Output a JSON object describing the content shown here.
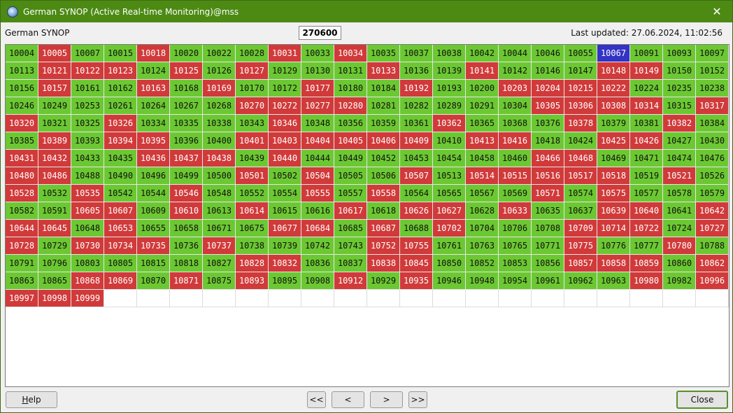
{
  "window": {
    "title": "German SYNOP (Active Real-time Monitoring)@mss"
  },
  "info": {
    "name": "German SYNOP",
    "center_value": "270600",
    "last_updated": "Last updated: 27.06.2024, 11:02:56"
  },
  "colors": {
    "ok": "#6cc832",
    "bad": "#d13a3a",
    "selected": "#3333c4"
  },
  "stations": [
    {
      "id": "10004",
      "s": "ok"
    },
    {
      "id": "10005",
      "s": "bad"
    },
    {
      "id": "10007",
      "s": "ok"
    },
    {
      "id": "10015",
      "s": "ok"
    },
    {
      "id": "10018",
      "s": "bad"
    },
    {
      "id": "10020",
      "s": "ok"
    },
    {
      "id": "10022",
      "s": "ok"
    },
    {
      "id": "10028",
      "s": "ok"
    },
    {
      "id": "10031",
      "s": "bad"
    },
    {
      "id": "10033",
      "s": "ok"
    },
    {
      "id": "10034",
      "s": "bad"
    },
    {
      "id": "10035",
      "s": "ok"
    },
    {
      "id": "10037",
      "s": "ok"
    },
    {
      "id": "10038",
      "s": "ok"
    },
    {
      "id": "10042",
      "s": "ok"
    },
    {
      "id": "10044",
      "s": "ok"
    },
    {
      "id": "10046",
      "s": "ok"
    },
    {
      "id": "10055",
      "s": "ok"
    },
    {
      "id": "10067",
      "s": "sel"
    },
    {
      "id": "10091",
      "s": "ok"
    },
    {
      "id": "10093",
      "s": "ok"
    },
    {
      "id": "10097",
      "s": "ok"
    },
    {
      "id": "10113",
      "s": "ok"
    },
    {
      "id": "10121",
      "s": "bad"
    },
    {
      "id": "10122",
      "s": "bad"
    },
    {
      "id": "10123",
      "s": "bad"
    },
    {
      "id": "10124",
      "s": "ok"
    },
    {
      "id": "10125",
      "s": "bad"
    },
    {
      "id": "10126",
      "s": "ok"
    },
    {
      "id": "10127",
      "s": "bad"
    },
    {
      "id": "10129",
      "s": "ok"
    },
    {
      "id": "10130",
      "s": "ok"
    },
    {
      "id": "10131",
      "s": "ok"
    },
    {
      "id": "10133",
      "s": "bad"
    },
    {
      "id": "10136",
      "s": "ok"
    },
    {
      "id": "10139",
      "s": "ok"
    },
    {
      "id": "10141",
      "s": "bad"
    },
    {
      "id": "10142",
      "s": "ok"
    },
    {
      "id": "10146",
      "s": "ok"
    },
    {
      "id": "10147",
      "s": "ok"
    },
    {
      "id": "10148",
      "s": "bad"
    },
    {
      "id": "10149",
      "s": "bad"
    },
    {
      "id": "10150",
      "s": "ok"
    },
    {
      "id": "10152",
      "s": "ok"
    },
    {
      "id": "10156",
      "s": "ok"
    },
    {
      "id": "10157",
      "s": "bad"
    },
    {
      "id": "10161",
      "s": "ok"
    },
    {
      "id": "10162",
      "s": "ok"
    },
    {
      "id": "10163",
      "s": "bad"
    },
    {
      "id": "10168",
      "s": "ok"
    },
    {
      "id": "10169",
      "s": "bad"
    },
    {
      "id": "10170",
      "s": "ok"
    },
    {
      "id": "10172",
      "s": "ok"
    },
    {
      "id": "10177",
      "s": "bad"
    },
    {
      "id": "10180",
      "s": "ok"
    },
    {
      "id": "10184",
      "s": "ok"
    },
    {
      "id": "10192",
      "s": "bad"
    },
    {
      "id": "10193",
      "s": "ok"
    },
    {
      "id": "10200",
      "s": "ok"
    },
    {
      "id": "10203",
      "s": "bad"
    },
    {
      "id": "10204",
      "s": "bad"
    },
    {
      "id": "10215",
      "s": "bad"
    },
    {
      "id": "10222",
      "s": "bad"
    },
    {
      "id": "10224",
      "s": "ok"
    },
    {
      "id": "10235",
      "s": "ok"
    },
    {
      "id": "10238",
      "s": "ok"
    },
    {
      "id": "10246",
      "s": "ok"
    },
    {
      "id": "10249",
      "s": "ok"
    },
    {
      "id": "10253",
      "s": "ok"
    },
    {
      "id": "10261",
      "s": "ok"
    },
    {
      "id": "10264",
      "s": "ok"
    },
    {
      "id": "10267",
      "s": "ok"
    },
    {
      "id": "10268",
      "s": "ok"
    },
    {
      "id": "10270",
      "s": "bad"
    },
    {
      "id": "10272",
      "s": "bad"
    },
    {
      "id": "10277",
      "s": "bad"
    },
    {
      "id": "10280",
      "s": "bad"
    },
    {
      "id": "10281",
      "s": "ok"
    },
    {
      "id": "10282",
      "s": "ok"
    },
    {
      "id": "10289",
      "s": "ok"
    },
    {
      "id": "10291",
      "s": "ok"
    },
    {
      "id": "10304",
      "s": "ok"
    },
    {
      "id": "10305",
      "s": "bad"
    },
    {
      "id": "10306",
      "s": "bad"
    },
    {
      "id": "10308",
      "s": "bad"
    },
    {
      "id": "10314",
      "s": "bad"
    },
    {
      "id": "10315",
      "s": "ok"
    },
    {
      "id": "10317",
      "s": "bad"
    },
    {
      "id": "10320",
      "s": "bad"
    },
    {
      "id": "10321",
      "s": "ok"
    },
    {
      "id": "10325",
      "s": "ok"
    },
    {
      "id": "10326",
      "s": "bad"
    },
    {
      "id": "10334",
      "s": "ok"
    },
    {
      "id": "10335",
      "s": "ok"
    },
    {
      "id": "10338",
      "s": "ok"
    },
    {
      "id": "10343",
      "s": "ok"
    },
    {
      "id": "10346",
      "s": "bad"
    },
    {
      "id": "10348",
      "s": "ok"
    },
    {
      "id": "10356",
      "s": "ok"
    },
    {
      "id": "10359",
      "s": "ok"
    },
    {
      "id": "10361",
      "s": "ok"
    },
    {
      "id": "10362",
      "s": "bad"
    },
    {
      "id": "10365",
      "s": "ok"
    },
    {
      "id": "10368",
      "s": "ok"
    },
    {
      "id": "10376",
      "s": "ok"
    },
    {
      "id": "10378",
      "s": "bad"
    },
    {
      "id": "10379",
      "s": "ok"
    },
    {
      "id": "10381",
      "s": "ok"
    },
    {
      "id": "10382",
      "s": "bad"
    },
    {
      "id": "10384",
      "s": "ok"
    },
    {
      "id": "10385",
      "s": "ok"
    },
    {
      "id": "10389",
      "s": "bad"
    },
    {
      "id": "10393",
      "s": "ok"
    },
    {
      "id": "10394",
      "s": "bad"
    },
    {
      "id": "10395",
      "s": "bad"
    },
    {
      "id": "10396",
      "s": "ok"
    },
    {
      "id": "10400",
      "s": "ok"
    },
    {
      "id": "10401",
      "s": "bad"
    },
    {
      "id": "10403",
      "s": "bad"
    },
    {
      "id": "10404",
      "s": "bad"
    },
    {
      "id": "10405",
      "s": "bad"
    },
    {
      "id": "10406",
      "s": "bad"
    },
    {
      "id": "10409",
      "s": "bad"
    },
    {
      "id": "10410",
      "s": "ok"
    },
    {
      "id": "10413",
      "s": "bad"
    },
    {
      "id": "10416",
      "s": "bad"
    },
    {
      "id": "10418",
      "s": "ok"
    },
    {
      "id": "10424",
      "s": "ok"
    },
    {
      "id": "10425",
      "s": "bad"
    },
    {
      "id": "10426",
      "s": "bad"
    },
    {
      "id": "10427",
      "s": "ok"
    },
    {
      "id": "10430",
      "s": "ok"
    },
    {
      "id": "10431",
      "s": "bad"
    },
    {
      "id": "10432",
      "s": "bad"
    },
    {
      "id": "10433",
      "s": "ok"
    },
    {
      "id": "10435",
      "s": "ok"
    },
    {
      "id": "10436",
      "s": "bad"
    },
    {
      "id": "10437",
      "s": "bad"
    },
    {
      "id": "10438",
      "s": "bad"
    },
    {
      "id": "10439",
      "s": "ok"
    },
    {
      "id": "10440",
      "s": "bad"
    },
    {
      "id": "10444",
      "s": "ok"
    },
    {
      "id": "10449",
      "s": "ok"
    },
    {
      "id": "10452",
      "s": "ok"
    },
    {
      "id": "10453",
      "s": "ok"
    },
    {
      "id": "10454",
      "s": "ok"
    },
    {
      "id": "10458",
      "s": "ok"
    },
    {
      "id": "10460",
      "s": "ok"
    },
    {
      "id": "10466",
      "s": "bad"
    },
    {
      "id": "10468",
      "s": "bad"
    },
    {
      "id": "10469",
      "s": "ok"
    },
    {
      "id": "10471",
      "s": "ok"
    },
    {
      "id": "10474",
      "s": "ok"
    },
    {
      "id": "10476",
      "s": "ok"
    },
    {
      "id": "10480",
      "s": "bad"
    },
    {
      "id": "10486",
      "s": "bad"
    },
    {
      "id": "10488",
      "s": "ok"
    },
    {
      "id": "10490",
      "s": "ok"
    },
    {
      "id": "10496",
      "s": "ok"
    },
    {
      "id": "10499",
      "s": "ok"
    },
    {
      "id": "10500",
      "s": "ok"
    },
    {
      "id": "10501",
      "s": "bad"
    },
    {
      "id": "10502",
      "s": "ok"
    },
    {
      "id": "10504",
      "s": "bad"
    },
    {
      "id": "10505",
      "s": "ok"
    },
    {
      "id": "10506",
      "s": "ok"
    },
    {
      "id": "10507",
      "s": "bad"
    },
    {
      "id": "10513",
      "s": "ok"
    },
    {
      "id": "10514",
      "s": "bad"
    },
    {
      "id": "10515",
      "s": "bad"
    },
    {
      "id": "10516",
      "s": "bad"
    },
    {
      "id": "10517",
      "s": "bad"
    },
    {
      "id": "10518",
      "s": "bad"
    },
    {
      "id": "10519",
      "s": "ok"
    },
    {
      "id": "10521",
      "s": "bad"
    },
    {
      "id": "10526",
      "s": "ok"
    },
    {
      "id": "10528",
      "s": "bad"
    },
    {
      "id": "10532",
      "s": "ok"
    },
    {
      "id": "10535",
      "s": "bad"
    },
    {
      "id": "10542",
      "s": "ok"
    },
    {
      "id": "10544",
      "s": "ok"
    },
    {
      "id": "10546",
      "s": "bad"
    },
    {
      "id": "10548",
      "s": "ok"
    },
    {
      "id": "10552",
      "s": "ok"
    },
    {
      "id": "10554",
      "s": "ok"
    },
    {
      "id": "10555",
      "s": "bad"
    },
    {
      "id": "10557",
      "s": "ok"
    },
    {
      "id": "10558",
      "s": "bad"
    },
    {
      "id": "10564",
      "s": "ok"
    },
    {
      "id": "10565",
      "s": "ok"
    },
    {
      "id": "10567",
      "s": "ok"
    },
    {
      "id": "10569",
      "s": "ok"
    },
    {
      "id": "10571",
      "s": "bad"
    },
    {
      "id": "10574",
      "s": "ok"
    },
    {
      "id": "10575",
      "s": "bad"
    },
    {
      "id": "10577",
      "s": "ok"
    },
    {
      "id": "10578",
      "s": "ok"
    },
    {
      "id": "10579",
      "s": "ok"
    },
    {
      "id": "10582",
      "s": "ok"
    },
    {
      "id": "10591",
      "s": "ok"
    },
    {
      "id": "10605",
      "s": "bad"
    },
    {
      "id": "10607",
      "s": "bad"
    },
    {
      "id": "10609",
      "s": "ok"
    },
    {
      "id": "10610",
      "s": "bad"
    },
    {
      "id": "10613",
      "s": "ok"
    },
    {
      "id": "10614",
      "s": "bad"
    },
    {
      "id": "10615",
      "s": "ok"
    },
    {
      "id": "10616",
      "s": "ok"
    },
    {
      "id": "10617",
      "s": "bad"
    },
    {
      "id": "10618",
      "s": "ok"
    },
    {
      "id": "10626",
      "s": "bad"
    },
    {
      "id": "10627",
      "s": "bad"
    },
    {
      "id": "10628",
      "s": "ok"
    },
    {
      "id": "10633",
      "s": "bad"
    },
    {
      "id": "10635",
      "s": "ok"
    },
    {
      "id": "10637",
      "s": "ok"
    },
    {
      "id": "10639",
      "s": "bad"
    },
    {
      "id": "10640",
      "s": "bad"
    },
    {
      "id": "10641",
      "s": "ok"
    },
    {
      "id": "10642",
      "s": "bad"
    },
    {
      "id": "10644",
      "s": "bad"
    },
    {
      "id": "10645",
      "s": "bad"
    },
    {
      "id": "10648",
      "s": "ok"
    },
    {
      "id": "10653",
      "s": "bad"
    },
    {
      "id": "10655",
      "s": "ok"
    },
    {
      "id": "10658",
      "s": "ok"
    },
    {
      "id": "10671",
      "s": "ok"
    },
    {
      "id": "10675",
      "s": "ok"
    },
    {
      "id": "10677",
      "s": "bad"
    },
    {
      "id": "10684",
      "s": "bad"
    },
    {
      "id": "10685",
      "s": "ok"
    },
    {
      "id": "10687",
      "s": "bad"
    },
    {
      "id": "10688",
      "s": "ok"
    },
    {
      "id": "10702",
      "s": "bad"
    },
    {
      "id": "10704",
      "s": "ok"
    },
    {
      "id": "10706",
      "s": "ok"
    },
    {
      "id": "10708",
      "s": "ok"
    },
    {
      "id": "10709",
      "s": "bad"
    },
    {
      "id": "10714",
      "s": "bad"
    },
    {
      "id": "10722",
      "s": "bad"
    },
    {
      "id": "10724",
      "s": "ok"
    },
    {
      "id": "10727",
      "s": "bad"
    },
    {
      "id": "10728",
      "s": "bad"
    },
    {
      "id": "10729",
      "s": "ok"
    },
    {
      "id": "10730",
      "s": "bad"
    },
    {
      "id": "10734",
      "s": "bad"
    },
    {
      "id": "10735",
      "s": "bad"
    },
    {
      "id": "10736",
      "s": "ok"
    },
    {
      "id": "10737",
      "s": "bad"
    },
    {
      "id": "10738",
      "s": "ok"
    },
    {
      "id": "10739",
      "s": "ok"
    },
    {
      "id": "10742",
      "s": "ok"
    },
    {
      "id": "10743",
      "s": "ok"
    },
    {
      "id": "10752",
      "s": "bad"
    },
    {
      "id": "10755",
      "s": "bad"
    },
    {
      "id": "10761",
      "s": "ok"
    },
    {
      "id": "10763",
      "s": "ok"
    },
    {
      "id": "10765",
      "s": "ok"
    },
    {
      "id": "10771",
      "s": "ok"
    },
    {
      "id": "10775",
      "s": "bad"
    },
    {
      "id": "10776",
      "s": "ok"
    },
    {
      "id": "10777",
      "s": "ok"
    },
    {
      "id": "10780",
      "s": "bad"
    },
    {
      "id": "10788",
      "s": "ok"
    },
    {
      "id": "10791",
      "s": "ok"
    },
    {
      "id": "10796",
      "s": "ok"
    },
    {
      "id": "10803",
      "s": "ok"
    },
    {
      "id": "10805",
      "s": "ok"
    },
    {
      "id": "10815",
      "s": "ok"
    },
    {
      "id": "10818",
      "s": "ok"
    },
    {
      "id": "10827",
      "s": "ok"
    },
    {
      "id": "10828",
      "s": "bad"
    },
    {
      "id": "10832",
      "s": "bad"
    },
    {
      "id": "10836",
      "s": "ok"
    },
    {
      "id": "10837",
      "s": "ok"
    },
    {
      "id": "10838",
      "s": "bad"
    },
    {
      "id": "10845",
      "s": "bad"
    },
    {
      "id": "10850",
      "s": "ok"
    },
    {
      "id": "10852",
      "s": "ok"
    },
    {
      "id": "10853",
      "s": "ok"
    },
    {
      "id": "10856",
      "s": "ok"
    },
    {
      "id": "10857",
      "s": "bad"
    },
    {
      "id": "10858",
      "s": "bad"
    },
    {
      "id": "10859",
      "s": "bad"
    },
    {
      "id": "10860",
      "s": "ok"
    },
    {
      "id": "10862",
      "s": "bad"
    },
    {
      "id": "10863",
      "s": "ok"
    },
    {
      "id": "10865",
      "s": "ok"
    },
    {
      "id": "10868",
      "s": "bad"
    },
    {
      "id": "10869",
      "s": "bad"
    },
    {
      "id": "10870",
      "s": "ok"
    },
    {
      "id": "10871",
      "s": "bad"
    },
    {
      "id": "10875",
      "s": "ok"
    },
    {
      "id": "10893",
      "s": "bad"
    },
    {
      "id": "10895",
      "s": "ok"
    },
    {
      "id": "10908",
      "s": "ok"
    },
    {
      "id": "10912",
      "s": "bad"
    },
    {
      "id": "10929",
      "s": "ok"
    },
    {
      "id": "10935",
      "s": "bad"
    },
    {
      "id": "10946",
      "s": "ok"
    },
    {
      "id": "10948",
      "s": "ok"
    },
    {
      "id": "10954",
      "s": "ok"
    },
    {
      "id": "10961",
      "s": "ok"
    },
    {
      "id": "10962",
      "s": "ok"
    },
    {
      "id": "10963",
      "s": "ok"
    },
    {
      "id": "10980",
      "s": "bad"
    },
    {
      "id": "10982",
      "s": "ok"
    },
    {
      "id": "10996",
      "s": "bad"
    },
    {
      "id": "10997",
      "s": "bad"
    },
    {
      "id": "10998",
      "s": "bad"
    },
    {
      "id": "10999",
      "s": "bad"
    }
  ],
  "buttons": {
    "help_hotkey": "H",
    "help_rest": "elp",
    "first": "<<",
    "prev": "<",
    "next": ">",
    "last": ">>",
    "close": "Close"
  }
}
